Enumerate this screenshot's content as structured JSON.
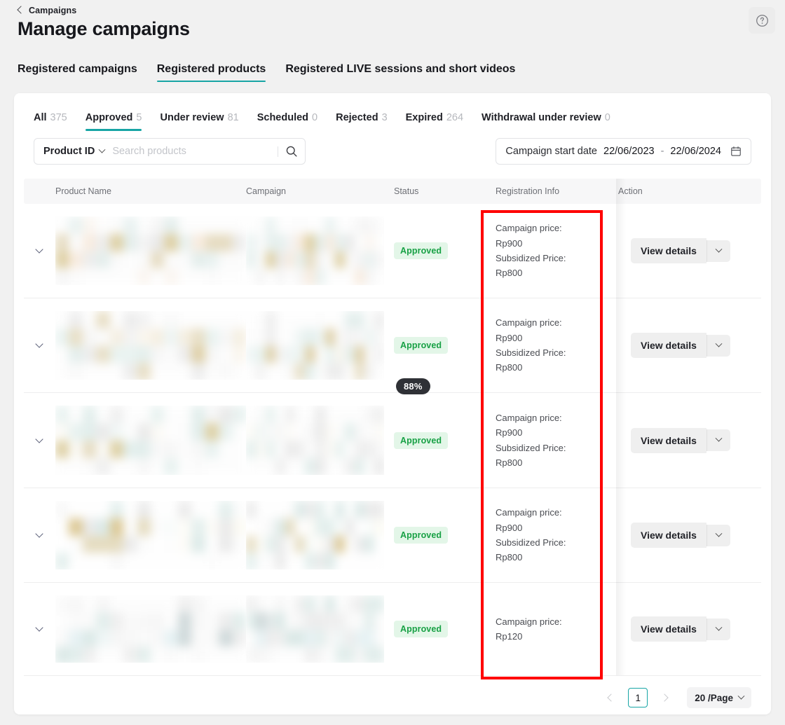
{
  "header": {
    "breadcrumb": "Campaigns",
    "title": "Manage campaigns",
    "help_icon": "question-circle-icon"
  },
  "main_tabs": [
    {
      "label": "Registered campaigns",
      "active": false
    },
    {
      "label": "Registered products",
      "active": true
    },
    {
      "label": "Registered LIVE sessions and short videos",
      "active": false
    }
  ],
  "status_tabs": [
    {
      "label": "All",
      "count": "375",
      "active": false
    },
    {
      "label": "Approved",
      "count": "5",
      "active": true
    },
    {
      "label": "Under review",
      "count": "81",
      "active": false
    },
    {
      "label": "Scheduled",
      "count": "0",
      "active": false
    },
    {
      "label": "Rejected",
      "count": "3",
      "active": false
    },
    {
      "label": "Expired",
      "count": "264",
      "active": false
    },
    {
      "label": "Withdrawal under review",
      "count": "0",
      "active": false
    }
  ],
  "search": {
    "field_label": "Product ID",
    "placeholder": "Search products",
    "value": "",
    "icon": "search-icon"
  },
  "date_filter": {
    "label": "Campaign start date",
    "start": "22/06/2023",
    "separator": "-",
    "end": "22/06/2024",
    "icon": "calendar-icon"
  },
  "table": {
    "columns": [
      "Product Name",
      "Campaign",
      "Status",
      "Registration Info",
      "Action"
    ],
    "rows": [
      {
        "status": "Approved",
        "registration_info": "Campaign price:\nRp900\nSubsidized Price:\nRp800",
        "action_label": "View details",
        "product_redacted": true
      },
      {
        "status": "Approved",
        "registration_info": "Campaign price:\nRp900\nSubsidized Price:\nRp800",
        "action_label": "View details",
        "product_redacted": true
      },
      {
        "status": "Approved",
        "registration_info": "Campaign price:\nRp900\nSubsidized Price:\nRp800",
        "action_label": "View details",
        "product_redacted": true,
        "tooltip": "88%"
      },
      {
        "status": "Approved",
        "registration_info": "Campaign price:\nRp900\nSubsidized Price:\nRp800",
        "action_label": "View details",
        "product_redacted": true
      },
      {
        "status": "Approved",
        "registration_info": "Campaign price:\nRp120",
        "action_label": "View details",
        "product_redacted": true
      }
    ]
  },
  "pagination": {
    "prev": "‹",
    "current_page": "1",
    "next": "›",
    "page_size": "20 /Page"
  },
  "colors": {
    "accent": "#17a5a5",
    "badge_text": "#18a145",
    "badge_bg": "#e3f6e8",
    "annotation": "#ff0000",
    "tooltip_bg": "#2f3136"
  }
}
